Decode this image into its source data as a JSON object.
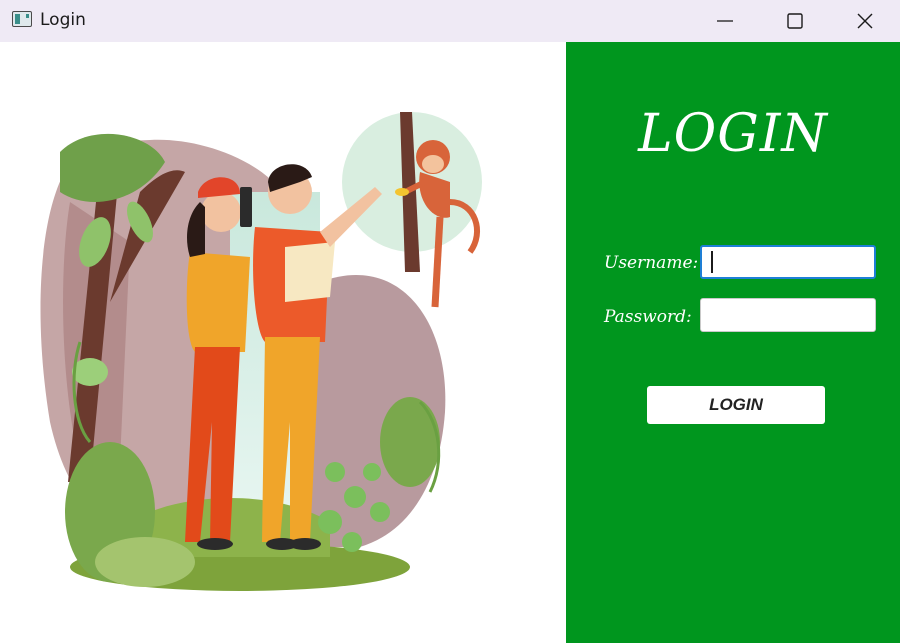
{
  "window": {
    "title": "Login",
    "icons": {
      "app": "app-window-icon",
      "minimize": "minimize-icon",
      "maximize": "maximize-icon",
      "close": "close-icon"
    }
  },
  "illustration": {
    "description_icon": "travel-couple-monkey-illustration"
  },
  "form": {
    "heading": "LOGIN",
    "username_label": "Username:",
    "username_value": "",
    "password_label": "Password:",
    "password_value": "",
    "submit_label": "LOGIN"
  },
  "colors": {
    "panel_bg": "#00961e",
    "titlebar_bg": "#efeaf5",
    "focus_border": "#1e7fd6"
  }
}
